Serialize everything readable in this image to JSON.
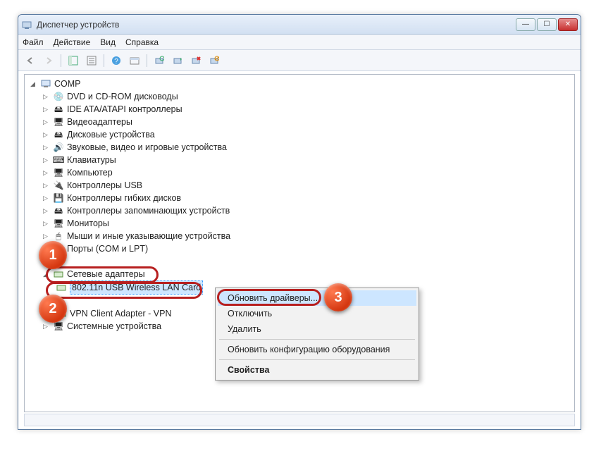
{
  "window": {
    "title": "Диспетчер устройств"
  },
  "menu": {
    "file": "Файл",
    "action": "Действие",
    "view": "Вид",
    "help": "Справка"
  },
  "tree": {
    "root": "COMP",
    "items": [
      "DVD и CD-ROM дисководы",
      "IDE ATA/ATAPI контроллеры",
      "Видеоадаптеры",
      "Дисковые устройства",
      "Звуковые, видео и игровые устройства",
      "Клавиатуры",
      "Компьютер",
      "Контроллеры USB",
      "Контроллеры гибких дисков",
      "Контроллеры запоминающих устройств",
      "Мониторы",
      "Мыши и иные указывающие устройства",
      "Порты (COM и LPT)"
    ],
    "network_adapters_label": "Сетевые адаптеры",
    "selected_device": "802.11n USB Wireless LAN Card",
    "vpn_adapter": "VPN Client Adapter - VPN",
    "system_devices": "Системные устройства"
  },
  "context_menu": {
    "update": "Обновить драйверы...",
    "disable": "Отключить",
    "delete": "Удалить",
    "refresh_hw": "Обновить конфигурацию оборудования",
    "properties": "Свойства"
  },
  "badges": {
    "b1": "1",
    "b2": "2",
    "b3": "3"
  }
}
